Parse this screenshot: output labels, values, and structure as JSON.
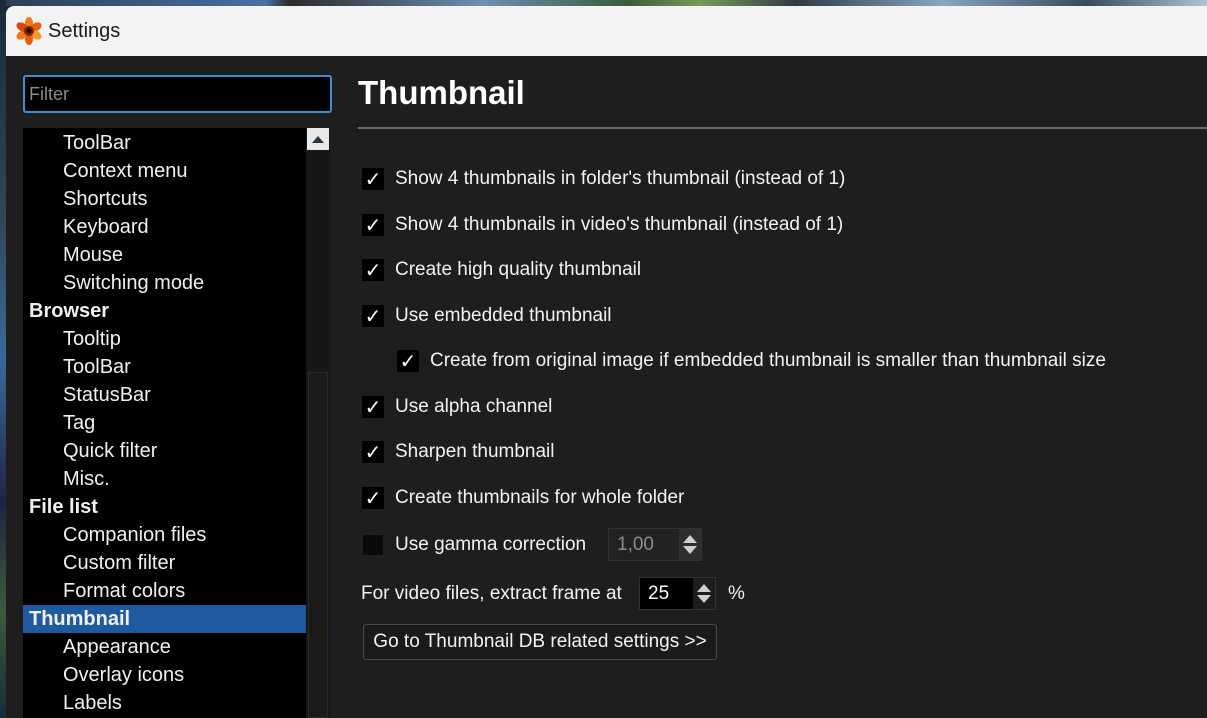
{
  "window": {
    "title": "Settings",
    "app_icon": "xnview-flower-icon"
  },
  "sidebar": {
    "filter_placeholder": "Filter",
    "items": [
      {
        "label": "ToolBar",
        "level": "child"
      },
      {
        "label": "Context menu",
        "level": "child"
      },
      {
        "label": "Shortcuts",
        "level": "child"
      },
      {
        "label": "Keyboard",
        "level": "child"
      },
      {
        "label": "Mouse",
        "level": "child"
      },
      {
        "label": "Switching mode",
        "level": "child"
      },
      {
        "label": "Browser",
        "level": "parent"
      },
      {
        "label": "Tooltip",
        "level": "child"
      },
      {
        "label": "ToolBar",
        "level": "child"
      },
      {
        "label": "StatusBar",
        "level": "child"
      },
      {
        "label": "Tag",
        "level": "child"
      },
      {
        "label": "Quick filter",
        "level": "child"
      },
      {
        "label": "Misc.",
        "level": "child"
      },
      {
        "label": "File list",
        "level": "parent"
      },
      {
        "label": "Companion files",
        "level": "child"
      },
      {
        "label": "Custom filter",
        "level": "child"
      },
      {
        "label": "Format colors",
        "level": "child"
      },
      {
        "label": "Thumbnail",
        "level": "parent",
        "selected": true
      },
      {
        "label": "Appearance",
        "level": "child"
      },
      {
        "label": "Overlay icons",
        "level": "child"
      },
      {
        "label": "Labels",
        "level": "child"
      }
    ],
    "selection_color": "#1f5aa0",
    "focus_color": "#3d8fd6"
  },
  "main": {
    "title": "Thumbnail",
    "options": {
      "show4_folder": {
        "label": "Show 4 thumbnails in folder's thumbnail (instead of 1)",
        "checked": true,
        "check_mark": "✓"
      },
      "show4_video": {
        "label": "Show 4 thumbnails in video's thumbnail (instead of 1)",
        "checked": true,
        "check_mark": "✓"
      },
      "high_quality": {
        "label": "Create high quality thumbnail",
        "checked": true,
        "check_mark": "✓"
      },
      "embedded": {
        "label": "Use embedded thumbnail",
        "checked": true,
        "check_mark": "✓"
      },
      "from_original": {
        "label": "Create from original image if embedded thumbnail is smaller than thumbnail size",
        "checked": true,
        "check_mark": "✓"
      },
      "alpha": {
        "label": "Use alpha channel",
        "checked": true,
        "check_mark": "✓"
      },
      "sharpen": {
        "label": "Sharpen thumbnail",
        "checked": true,
        "check_mark": "✓"
      },
      "whole_folder": {
        "label": "Create  thumbnails for whole folder",
        "checked": true,
        "check_mark": "✓"
      },
      "gamma": {
        "label": "Use gamma correction",
        "checked": false,
        "check_mark": "",
        "value": "1,00"
      }
    },
    "video_frame": {
      "label": "For video files, extract frame at",
      "value": "25",
      "unit": "%"
    },
    "db_button_label": "Go to Thumbnail DB related settings >>"
  }
}
